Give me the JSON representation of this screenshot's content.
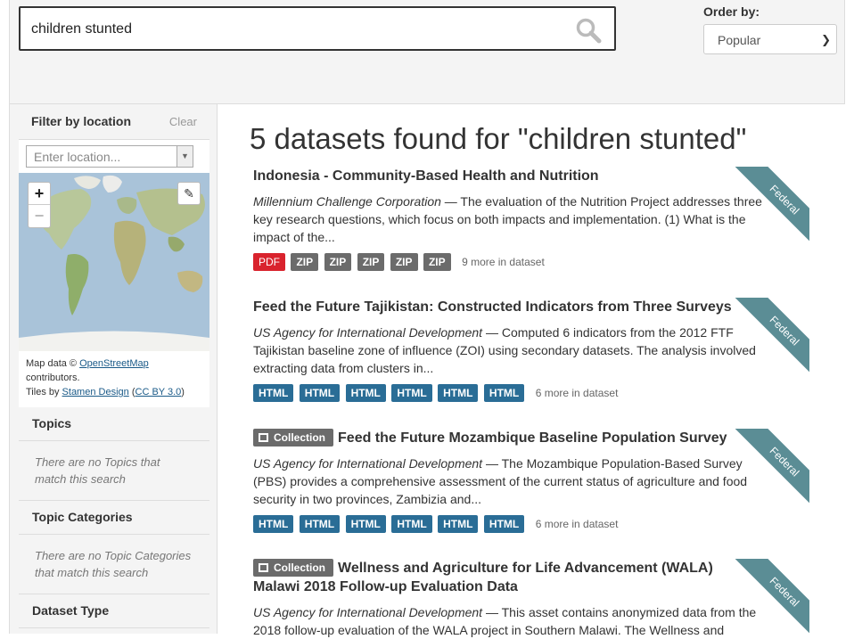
{
  "search": {
    "query": "children stunted"
  },
  "order": {
    "label": "Order by:",
    "selected": "Popular"
  },
  "sidebar": {
    "filter_location": {
      "title": "Filter by location",
      "clear": "Clear",
      "placeholder": "Enter location..."
    },
    "map": {
      "zoom_in": "+",
      "zoom_out": "−",
      "attribution": {
        "line1_prefix": "Map data © ",
        "osm": "OpenStreetMap",
        "line2": "contributors.",
        "line3_prefix": "Tiles by ",
        "stamen": "Stamen Design",
        "cc_open": " (",
        "cc": "CC BY 3.0",
        "cc_close": ")"
      }
    },
    "facets": [
      {
        "title": "Topics",
        "empty": "There are no Topics that match this search"
      },
      {
        "title": "Topic Categories",
        "empty": "There are no Topic Categories that match this search"
      },
      {
        "title": "Dataset Type"
      }
    ]
  },
  "results": {
    "heading": "5 datasets found for \"children stunted\"",
    "items": [
      {
        "title": "Indonesia - Community-Based Health and Nutrition",
        "org": "Millennium Challenge Corporation",
        "desc": " — The evaluation of the Nutrition Project addresses three key research questions, which focus on both impacts and implementation. (1) What is the impact of the...",
        "ribbon": "Federal",
        "formats": [
          "PDF",
          "ZIP",
          "ZIP",
          "ZIP",
          "ZIP",
          "ZIP"
        ],
        "more": "9 more in dataset"
      },
      {
        "title": "Feed the Future Tajikistan: Constructed Indicators from Three Surveys",
        "org": "US Agency for International Development",
        "desc": " — Computed 6 indicators from the 2012 FTF Tajikistan baseline zone of influence (ZOI) using secondary datasets. The analysis involved extracting data from clusters in...",
        "ribbon": "Federal",
        "formats": [
          "HTML",
          "HTML",
          "HTML",
          "HTML",
          "HTML",
          "HTML"
        ],
        "more": "6 more in dataset"
      },
      {
        "collection": "Collection",
        "title": "Feed the Future Mozambique Baseline Population Survey",
        "org": "US Agency for International Development",
        "desc": " — The Mozambique Population-Based Survey (PBS) provides a comprehensive assessment of the current status of agriculture and food security in two provinces, Zambizia and...",
        "ribbon": "Federal",
        "formats": [
          "HTML",
          "HTML",
          "HTML",
          "HTML",
          "HTML",
          "HTML"
        ],
        "more": "6 more in dataset"
      },
      {
        "collection": "Collection",
        "title": "Wellness and Agriculture for Life Advancement (WALA) Malawi 2018 Follow-up Evaluation Data",
        "org": "US Agency for International Development",
        "desc": " — This asset contains anonymized data from the 2018 follow-up evaluation of the WALA project in Southern Malawi. The Wellness and",
        "ribbon": "Federal"
      }
    ]
  },
  "colors": {
    "pdf": "#d9232d",
    "zip": "#6b6b6b",
    "html": "#2a6d96",
    "ribbon": "#5b8d95"
  }
}
